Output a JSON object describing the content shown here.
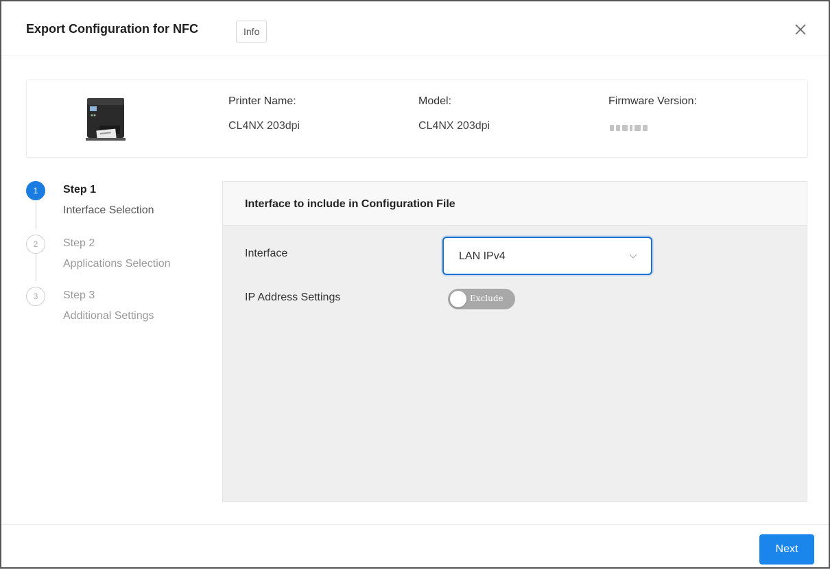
{
  "dialog": {
    "title": "Export Configuration for NFC",
    "info_label": "Info",
    "close_icon": "close-icon"
  },
  "printer": {
    "image_icon": "printer-image",
    "name_label": "Printer Name:",
    "name_value": "CL4NX 203dpi",
    "model_label": "Model:",
    "model_value": "CL4NX 203dpi",
    "firmware_label": "Firmware Version:"
  },
  "steps": [
    {
      "number": "1",
      "title": "Step 1",
      "subtitle": "Interface Selection",
      "state": "active"
    },
    {
      "number": "2",
      "title": "Step 2",
      "subtitle": "Applications Selection",
      "state": "inactive"
    },
    {
      "number": "3",
      "title": "Step 3",
      "subtitle": "Additional Settings",
      "state": "inactive"
    }
  ],
  "panel": {
    "title": "Interface to include in Configuration File",
    "interface_label": "Interface",
    "interface_value": "LAN IPv4",
    "ip_label": "IP Address Settings",
    "ip_toggle_label": "Exclude"
  },
  "footer": {
    "next_label": "Next"
  },
  "colors": {
    "accent": "#1a7be0",
    "button": "#1a86ec",
    "panel_bg": "#efefef"
  }
}
